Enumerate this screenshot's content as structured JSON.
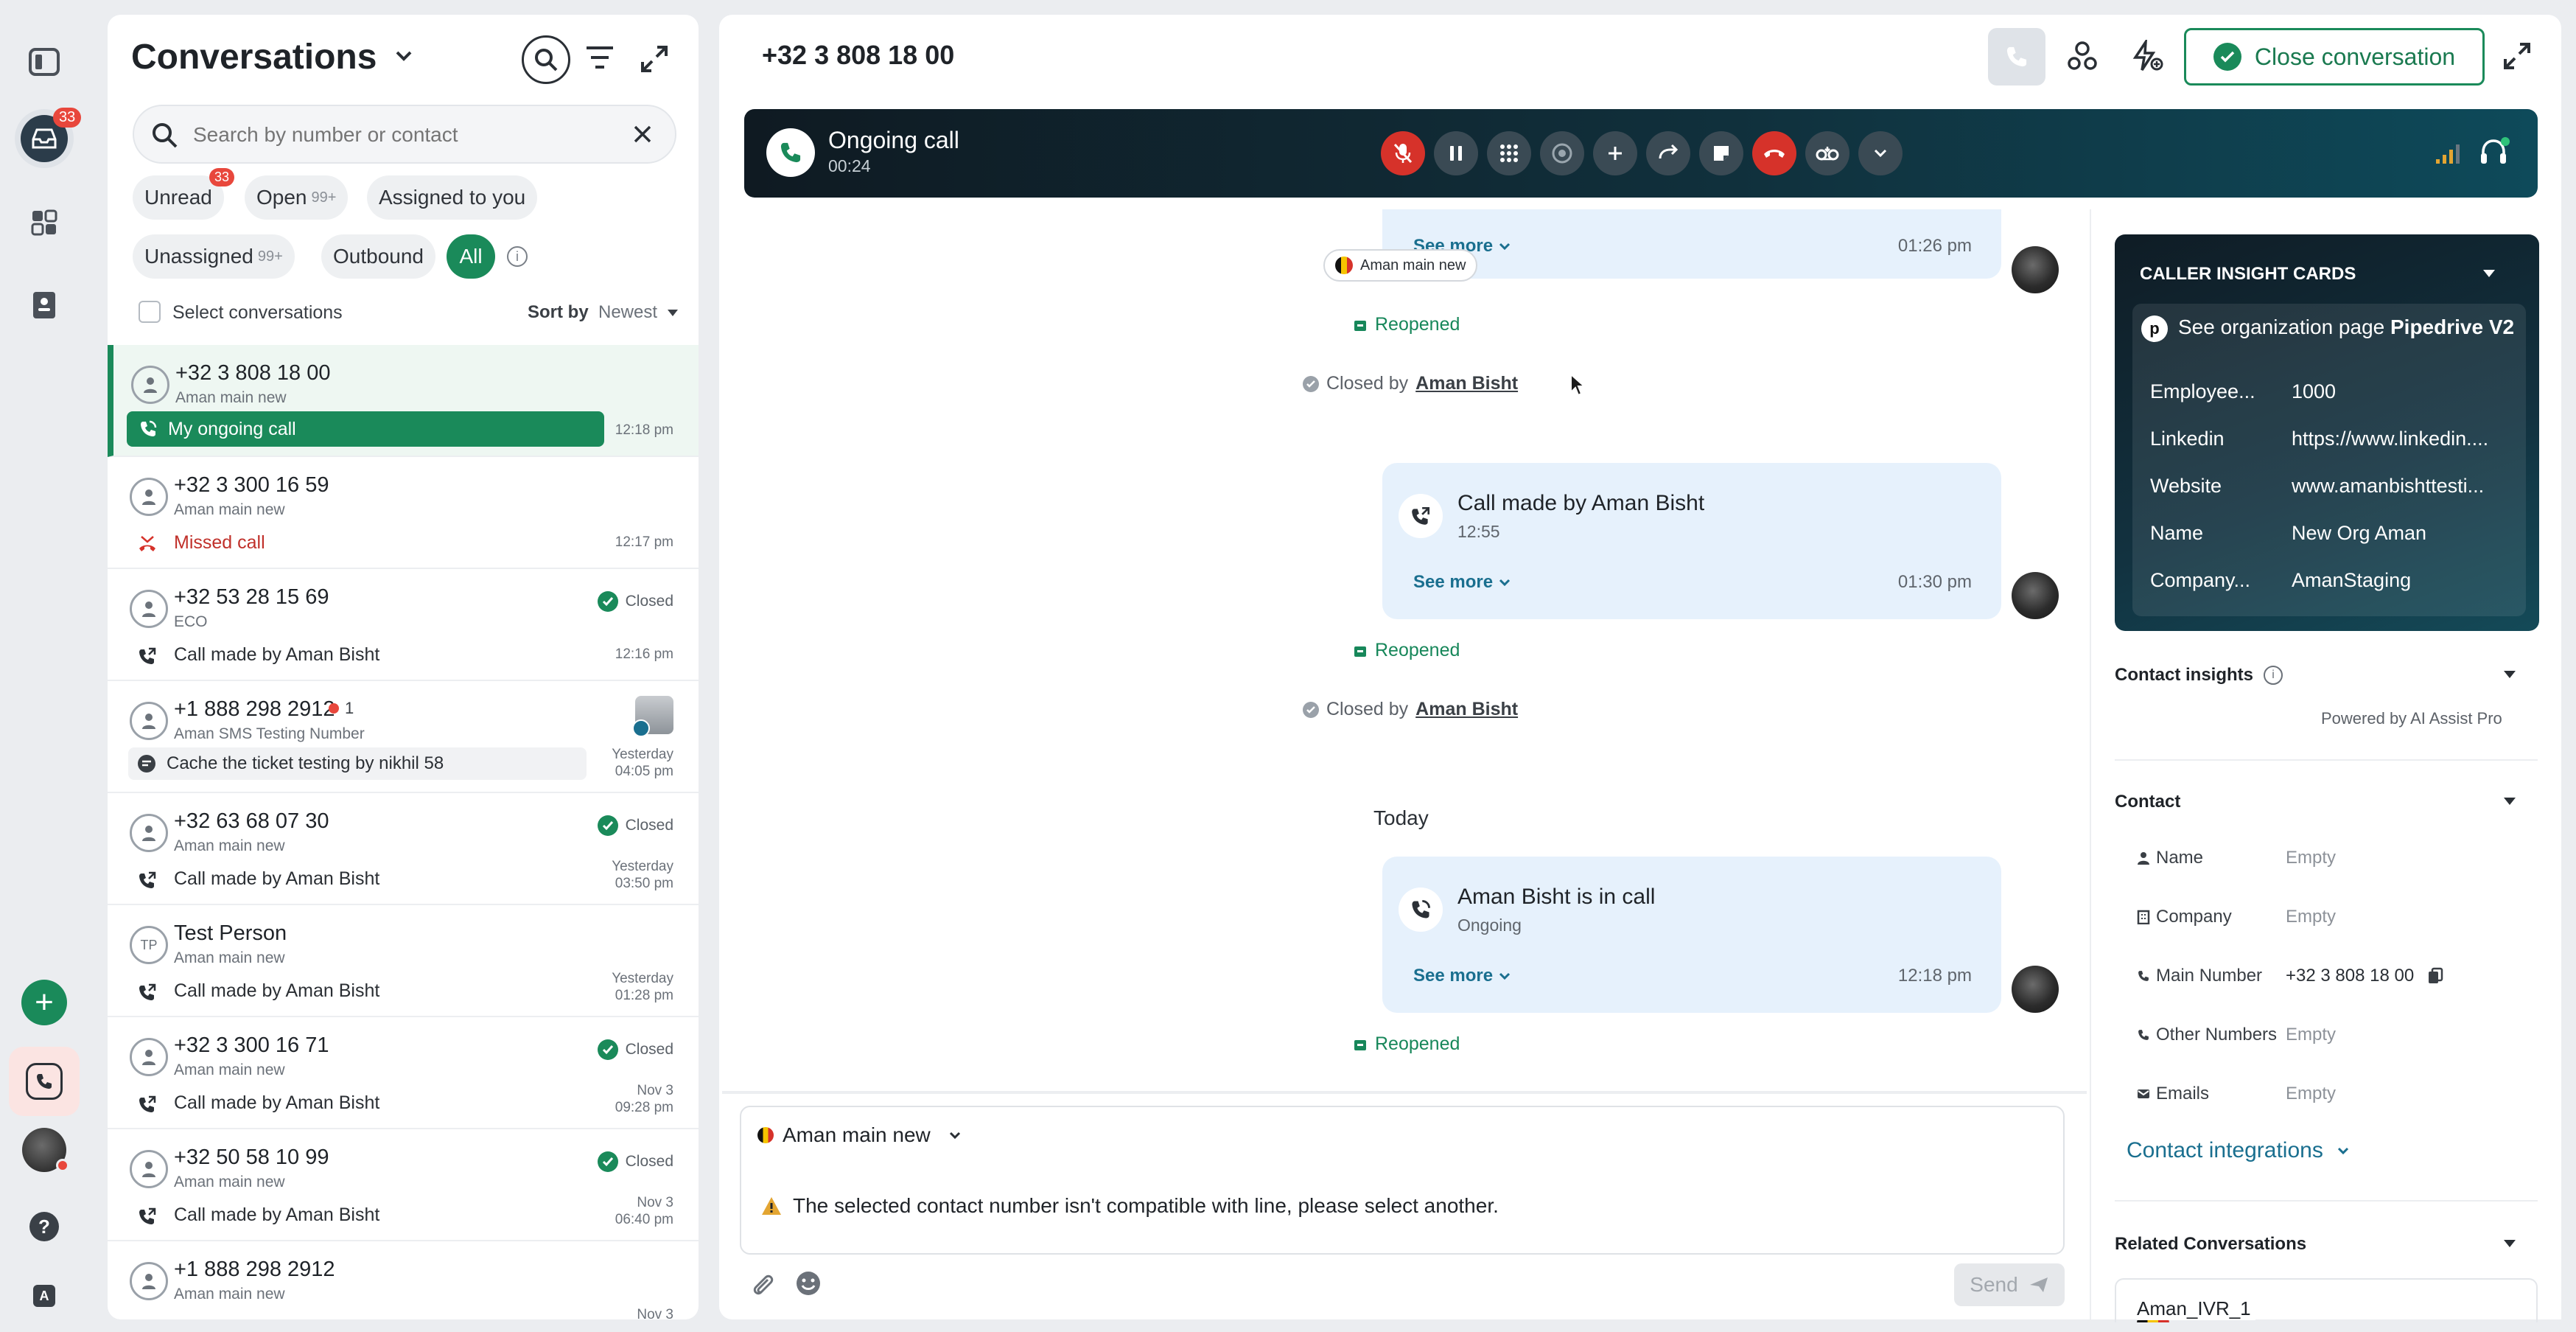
{
  "rail": {
    "badge": "33"
  },
  "conversations": {
    "title": "Conversations",
    "search_placeholder": "Search by number or contact",
    "filters": [
      {
        "label": "Unread",
        "badge": "33"
      },
      {
        "label": "Open",
        "count": "99+"
      },
      {
        "label": "Assigned to you"
      },
      {
        "label": "Unassigned",
        "count": "99+"
      },
      {
        "label": "Outbound"
      },
      {
        "label": "All"
      }
    ],
    "select_label": "Select conversations",
    "sort_label": "Sort by",
    "sort_value": "Newest",
    "items": [
      {
        "number": "+32 3 808 18 00",
        "sub": "Aman main new",
        "last": "My ongoing call",
        "time": "12:18 pm"
      },
      {
        "number": "+32 3 300 16 59",
        "sub": "Aman main new",
        "last": "Missed call",
        "time": "12:17 pm"
      },
      {
        "number": "+32 53 28 15 69",
        "sub": "ECO",
        "last": "Call made by Aman Bisht",
        "time": "12:16 pm",
        "status": "Closed"
      },
      {
        "number": "+1 888 298 2912",
        "sub": "Aman SMS Testing Number",
        "last": "Cache the ticket testing by nikhil 58",
        "time1": "Yesterday",
        "time2": "04:05 pm",
        "unread": "1"
      },
      {
        "number": "+32 63 68 07 30",
        "sub": "Aman main new",
        "last": "Call made by Aman Bisht",
        "time1": "Yesterday",
        "time2": "03:50 pm",
        "status": "Closed"
      },
      {
        "number": "Test Person",
        "initials": "TP",
        "sub": "Aman main new",
        "last": "Call made by Aman Bisht",
        "time1": "Yesterday",
        "time2": "01:28 pm"
      },
      {
        "number": "+32 3 300 16 71",
        "sub": "Aman main new",
        "last": "Call made by Aman Bisht",
        "time1": "Nov 3",
        "time2": "09:28 pm",
        "status": "Closed"
      },
      {
        "number": "+32 50 58 10 99",
        "sub": "Aman main new",
        "last": "Call made by Aman Bisht",
        "time1": "Nov 3",
        "time2": "06:40 pm",
        "status": "Closed"
      },
      {
        "number": "+1 888 298 2912",
        "sub": "Aman main new",
        "time1": "Nov 3"
      }
    ]
  },
  "header": {
    "number": "+32 3 808 18 00",
    "close_label": "Close conversation"
  },
  "callbar": {
    "title": "Ongoing call",
    "timer": "00:24"
  },
  "thread": {
    "line_chip": "Aman main new",
    "see_more": "See more",
    "m1": {
      "time": "01:26 pm"
    },
    "reopened": "Reopened",
    "closed_by": "Closed by",
    "closed_by_name": "Aman Bisht",
    "m2": {
      "title": "Call made by Aman Bisht",
      "sub": "12:55",
      "time": "01:30 pm"
    },
    "today": "Today",
    "m3": {
      "title": "Aman Bisht is in call",
      "sub": "Ongoing",
      "time": "12:18 pm"
    }
  },
  "composer": {
    "line": "Aman main new",
    "warning": "The selected contact number isn't compatible with line, please select another.",
    "send": "Send"
  },
  "insights": {
    "title": "CALLER INSIGHT CARDS",
    "org_link_prefix": "See organization page",
    "org_link_name": "Pipedrive V2",
    "rows": [
      {
        "label": "Employee...",
        "value": "1000"
      },
      {
        "label": "Linkedin",
        "value": "https://www.linkedin...."
      },
      {
        "label": "Website",
        "value": "www.amanbishttesti..."
      },
      {
        "label": "Name",
        "value": "New Org Aman"
      },
      {
        "label": "Company...",
        "value": "AmanStaging"
      }
    ]
  },
  "contact_insights": {
    "title": "Contact insights",
    "powered": "Powered by AI Assist Pro"
  },
  "contact": {
    "title": "Contact",
    "fields": [
      {
        "label": "Name",
        "value": "Empty"
      },
      {
        "label": "Company",
        "value": "Empty"
      },
      {
        "label": "Main Number",
        "value": "+32 3 808 18 00"
      },
      {
        "label": "Other Numbers",
        "value": "Empty"
      },
      {
        "label": "Emails",
        "value": "Empty"
      }
    ],
    "integrations": "Contact integrations"
  },
  "related": {
    "title": "Related Conversations",
    "first": "Aman_IVR_1"
  },
  "colors": {
    "brand_green": "#1a8a5a",
    "red": "#d6322a",
    "bubble": "#e6f1fc"
  }
}
